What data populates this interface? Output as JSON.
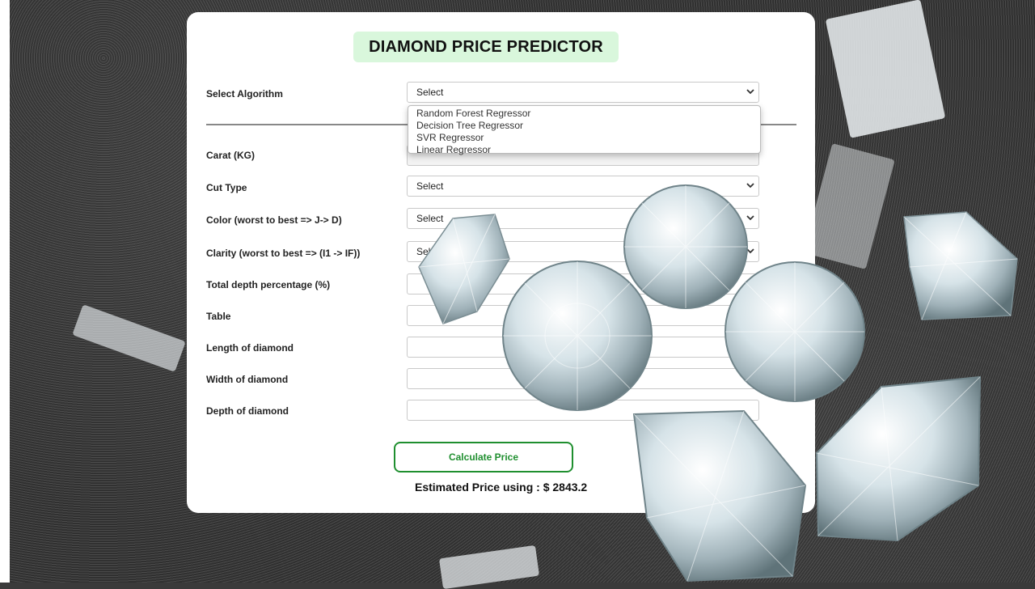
{
  "app": {
    "title": "DIAMOND PRICE PREDICTOR"
  },
  "algorithm": {
    "label": "Select Algorithm",
    "value": "Select",
    "options": [
      "Random Forest Regressor",
      "Decision Tree Regressor",
      "SVR Regressor",
      "Linear Regressor"
    ]
  },
  "fields": {
    "carat": {
      "label": "Carat (KG)",
      "value": ""
    },
    "cut": {
      "label": "Cut Type",
      "value": "Select"
    },
    "color": {
      "label": "Color (worst to best => J-> D)",
      "value": "Select"
    },
    "clarity": {
      "label": "Clarity (worst to best => (I1 -> IF))",
      "value": "Select"
    },
    "depth_pct": {
      "label": "Total depth percentage (%)",
      "value": ""
    },
    "table": {
      "label": "Table",
      "value": ""
    },
    "length": {
      "label": "Length of diamond",
      "value": ""
    },
    "width": {
      "label": "Width of diamond",
      "value": ""
    },
    "depth": {
      "label": "Depth of diamond",
      "value": ""
    }
  },
  "actions": {
    "calculate_label": "Calculate Price"
  },
  "result": {
    "text": "Estimated Price using : $ 2843.2"
  },
  "colors": {
    "accent": "#1f8f2f",
    "title_bg": "#d9f7dc"
  },
  "icons": {
    "select_chevron": "chevron-down-icon"
  }
}
